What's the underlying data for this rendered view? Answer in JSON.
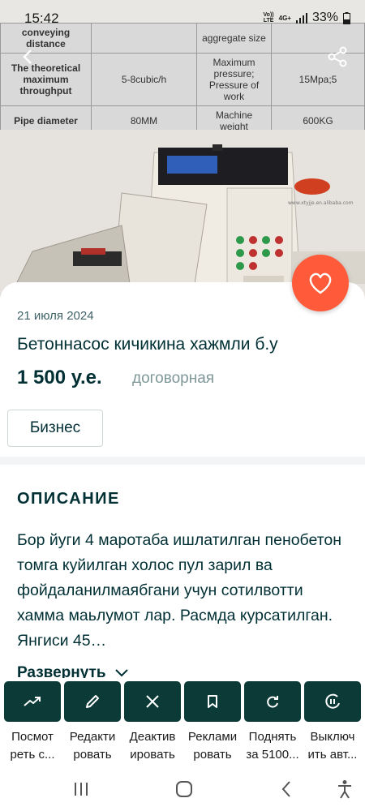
{
  "status": {
    "time": "15:42",
    "network_top": "Vo))",
    "network_bottom": "LTE",
    "signal_label": "4G+",
    "battery": "33%"
  },
  "photo": {
    "spec_rows": [
      [
        "conveying distance",
        "",
        "aggregate size",
        ""
      ],
      [
        "The theoretical maximum throughput",
        "5-8cubic/h",
        "Maximum pressure; Pressure of work",
        "15Mpa;5"
      ],
      [
        "Pipe diameter",
        "80MM",
        "Machine weight",
        "600KG"
      ]
    ],
    "machine_site_text": "www.xtyjje.en.alibaba.com"
  },
  "listing": {
    "date": "21 июля 2024",
    "title": "Бетоннасос кичикина хажмли б.у",
    "price": "1 500 у.е.",
    "negotiable": "договорная",
    "badge": "Бизнес"
  },
  "description": {
    "heading": "ОПИСАНИЕ",
    "text": "Бор йуги 4 маротаба ишлатилган пенобетон томга куйилган холос пул зарил ва фойдаланилмаябгани учун сотилвотти хамма маьлумот лар. Расмда курсатилган. Янгиси 45…",
    "expand": "Развернуть"
  },
  "actions": [
    {
      "line1": "Посмот",
      "line2": "реть с..."
    },
    {
      "line1": "Редакти",
      "line2": "ровать"
    },
    {
      "line1": "Деактив",
      "line2": "ировать"
    },
    {
      "line1": "Реклами",
      "line2": "ровать"
    },
    {
      "line1": "Поднять",
      "line2": "за 5100..."
    },
    {
      "line1": "Выключ",
      "line2": "ить авт..."
    }
  ],
  "colors": {
    "fav": "#ff5b3a",
    "action_bg": "#0c3a36",
    "text": "#002f34"
  }
}
